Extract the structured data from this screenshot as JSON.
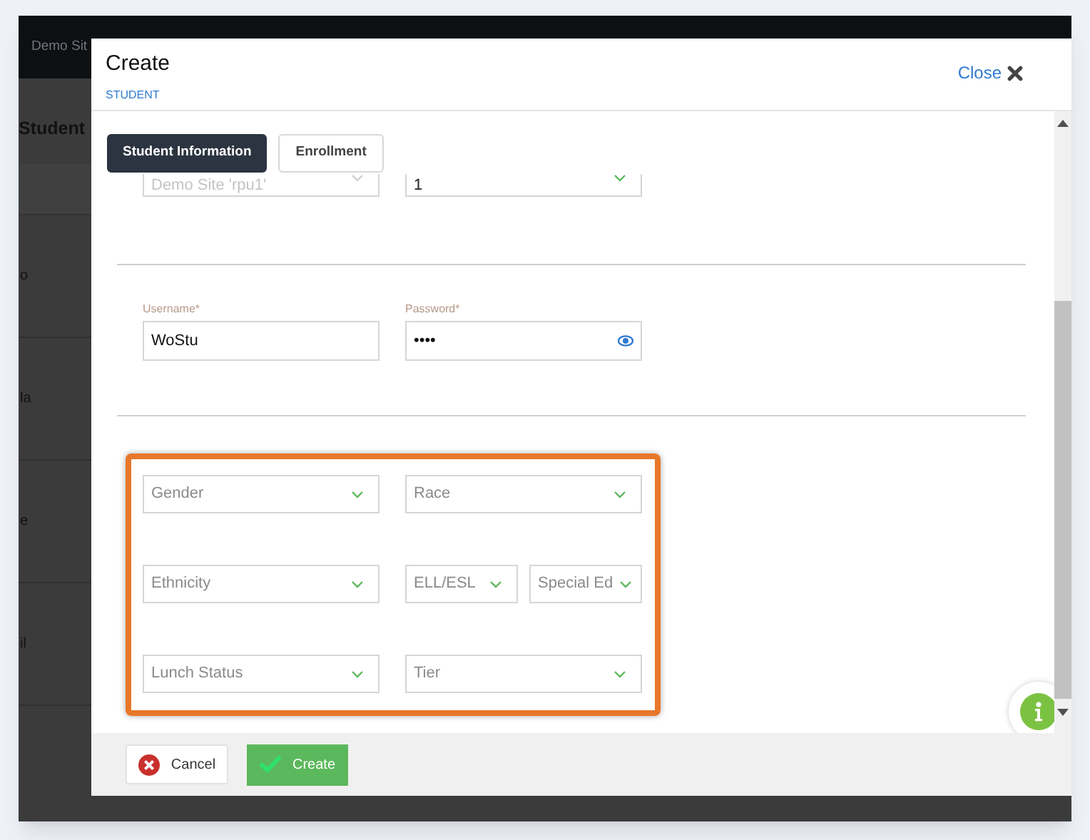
{
  "background": {
    "header_text": "Demo Sit",
    "page_title": "Student",
    "row_fragments": [
      "o",
      "la",
      "e",
      "il"
    ]
  },
  "dialog": {
    "title": "Create",
    "subtitle": "STUDENT",
    "close_label": "Close"
  },
  "tabs": [
    {
      "label": "Student Information",
      "selected": true
    },
    {
      "label": "Enrollment",
      "selected": false
    }
  ],
  "top_selects": [
    {
      "value": "Demo Site 'rpu1'",
      "disabled": true
    },
    {
      "value": "1",
      "disabled": false
    }
  ],
  "credentials": {
    "username": {
      "label": "Username*",
      "value": "WoStu"
    },
    "password": {
      "label": "Password*",
      "value": "••••"
    }
  },
  "highlighted_selects": [
    [
      {
        "placeholder": "Gender"
      },
      {
        "placeholder": "Race"
      }
    ],
    [
      {
        "placeholder": "Ethnicity"
      },
      {
        "placeholder": "ELL/ESL"
      },
      {
        "placeholder": "Special Ed"
      }
    ],
    [
      {
        "placeholder": "Lunch Status"
      },
      {
        "placeholder": "Tier"
      }
    ]
  ],
  "footer": {
    "cancel": "Cancel",
    "create": "Create"
  }
}
